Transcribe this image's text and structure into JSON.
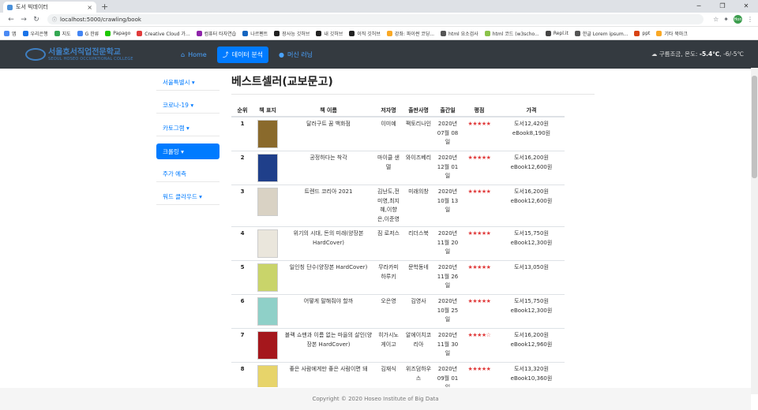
{
  "browser": {
    "tab_title": "도서 빅데이터",
    "new_tab": "+",
    "url": "localhost:5000/crawling/book",
    "profile_label": "Hon",
    "bookmarks": [
      {
        "label": "앱",
        "color": "#4a8af4"
      },
      {
        "label": "우리은행",
        "color": "#1a73e8"
      },
      {
        "label": "지도",
        "color": "#34a853"
      },
      {
        "label": "G 한류",
        "color": "#4285f4"
      },
      {
        "label": "Papago",
        "color": "#1ec800"
      },
      {
        "label": "Creative Cloud 가...",
        "color": "#e03b3b"
      },
      {
        "label": "컴퓨터 타자연습",
        "color": "#8e24aa"
      },
      {
        "label": "나르펜트",
        "color": "#1565c0"
      },
      {
        "label": "장사능 깃허브",
        "color": "#222222"
      },
      {
        "label": "내 깃허브",
        "color": "#222222"
      },
      {
        "label": "이직 깃허브",
        "color": "#222222"
      },
      {
        "label": "강좌: 파이썬 코딩...",
        "color": "#f9a825"
      },
      {
        "label": "html 요소검사",
        "color": "#555555"
      },
      {
        "label": "html 코드 (w3scho...",
        "color": "#8bc34a"
      },
      {
        "label": "Repl.it",
        "color": "#444444"
      },
      {
        "label": "한글 Lorem ipsum...",
        "color": "#555555"
      },
      {
        "label": "ppt",
        "color": "#d84315"
      },
      {
        "label": "기타 북마크",
        "color": "#f9a825"
      }
    ]
  },
  "site": {
    "logo_title": "서울호서직업전문학교",
    "logo_sub": "SEOUL HOSEO OCCUPATIONAL COLLEGE",
    "nav": [
      {
        "label": "Home",
        "icon": "home-icon",
        "glyph": "⌂"
      },
      {
        "label": "데이터 분석",
        "icon": "chart-icon",
        "glyph": "📈"
      },
      {
        "label": "머신 러닝",
        "icon": "globe-icon",
        "glyph": "●"
      }
    ],
    "weather": {
      "prefix": "구름조금, 온도: ",
      "temp": "-5.4℃",
      "range": ", -6/-5℃"
    }
  },
  "sidebar": [
    {
      "label": "서울특별시 ▾"
    },
    {
      "label": "코로나-19 ▾"
    },
    {
      "label": "카토그램 ▾"
    },
    {
      "label": "크롤링 ▾"
    },
    {
      "label": "주가 예측"
    },
    {
      "label": "워드 클라우드 ▾"
    }
  ],
  "page_title": "베스트셀러(교보문고)",
  "table": {
    "headers": [
      "순위",
      "책 표지",
      "책 이름",
      "저자명",
      "출판사명",
      "출간일",
      "평점",
      "가격"
    ],
    "rows": [
      {
        "rank": "1",
        "title": "달러구트 꿈 백화점",
        "author": "이미예",
        "publisher": "팩토리나인",
        "date": "2020년 07월 08일",
        "rating": "★★★★★",
        "price": "도서12,420원 eBook8,190원",
        "cover": "#8a6a2c"
      },
      {
        "rank": "2",
        "title": "공정하다는 착각",
        "author": "마이클 샌델",
        "publisher": "와이즈베리",
        "date": "2020년 12월 01일",
        "rating": "★★★★★",
        "price": "도서16,200원 eBook12,600원",
        "cover": "#1f3f8a"
      },
      {
        "rank": "3",
        "title": "트렌드 코리아 2021",
        "author": "김난도,전미영,최지혜,이향은,이준영",
        "publisher": "미래의창",
        "date": "2020년 10월 13일",
        "rating": "★★★★★",
        "price": "도서16,200원 eBook12,600원",
        "cover": "#d9d2c4"
      },
      {
        "rank": "4",
        "title": "위기의 시대, 돈의 미래(양장본 HardCover)",
        "author": "짐 로저스",
        "publisher": "리더스북",
        "date": "2020년 11월 20일",
        "rating": "★★★★★",
        "price": "도서15,750원 eBook12,300원",
        "cover": "#eae6dc"
      },
      {
        "rank": "5",
        "title": "일인칭 단수(양장본 HardCover)",
        "author": "무라카미 하루키",
        "publisher": "문학동네",
        "date": "2020년 11월 26일",
        "rating": "★★★★★",
        "price": "도서13,050원",
        "cover": "#c9d46a"
      },
      {
        "rank": "6",
        "title": "어떻게 말해줘야 할까",
        "author": "오은영",
        "publisher": "김영사",
        "date": "2020년 10월 25일",
        "rating": "★★★★★",
        "price": "도서15,750원 eBook12,300원",
        "cover": "#8fd0c8"
      },
      {
        "rank": "7",
        "title": "블랙 쇼맨과 이름 없는 마을의 살인(양장본 HardCover)",
        "author": "히가시노 게이고",
        "publisher": "알에이치코리아",
        "date": "2020년 11월 30일",
        "rating": "★★★★☆",
        "price": "도서16,200원 eBook12,960원",
        "cover": "#a5171c"
      },
      {
        "rank": "8",
        "title": "좋은 사람에게만 좋은 사람이면 돼",
        "author": "김재식",
        "publisher": "위즈덤하우스",
        "date": "2020년 09월 01일",
        "rating": "★★★★★",
        "price": "도서13,320원 eBook10,360원",
        "cover": "#e7d46a"
      }
    ]
  },
  "footer": "Copyright © 2020 Hoseo Institute of Big Data"
}
